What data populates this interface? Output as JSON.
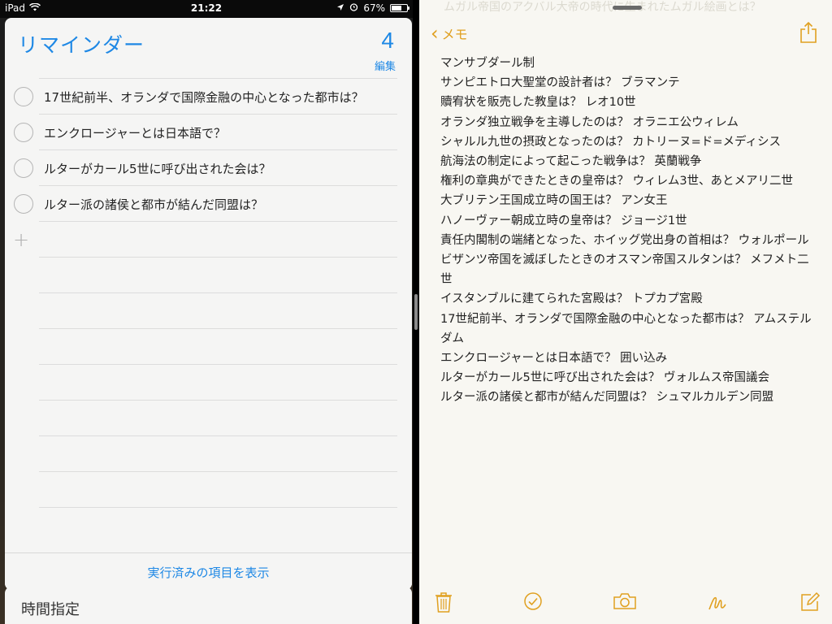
{
  "status_bar": {
    "device": "iPad",
    "time": "21:22",
    "battery": "67%",
    "battery_level": 0.67
  },
  "reminders": {
    "title": "リマインダー",
    "count": "4",
    "edit_label": "編集",
    "items": [
      "17世紀前半、オランダで国際金融の中心となった都市は？",
      "エンクロージャーとは日本語で？",
      "ルターがカール5世に呼び出された会は？",
      "ルター派の諸侯と都市が結んだ同盟は？"
    ],
    "show_completed_label": "実行済みの項目を表示",
    "next_list_title": "時間指定"
  },
  "notes": {
    "back_label": "メモ",
    "ghost_text": "ムガル帝国のアクバル大帝の時代に生まれたムガル絵画とは？",
    "lines": [
      "マンサブダール制",
      "サンピエトロ大聖堂の設計者は？ ブラマンテ",
      "贖宥状を販売した教皇は？ レオ10世",
      "オランダ独立戦争を主導したのは？ オラニエ公ウィレム",
      "シャルル九世の摂政となったのは？ カトリーヌ=ド=メディシス",
      "航海法の制定によって起こった戦争は？ 英蘭戦争",
      "権利の章典ができたときの皇帝は？ ウィレム3世、あとメアリ二世",
      "大ブリテン王国成立時の国王は？ アン女王",
      "ハノーヴァー朝成立時の皇帝は？ ジョージ1世",
      "責任内閣制の端緒となった、ホイッグ党出身の首相は？ ウォルポール",
      "ビザンツ帝国を滅ぼしたときのオスマン帝国スルタンは？ メフメト二世",
      "イスタンブルに建てられた宮殿は？ トプカプ宮殿",
      "17世紀前半、オランダで国際金融の中心となった都市は？ アムステルダム",
      "エンクロージャーとは日本語で？ 囲い込み",
      "ルターがカール5世に呼び出された会は？ ヴォルムス帝国議会",
      "ルター派の諸侯と都市が結んだ同盟は？ シュマルカルデン同盟"
    ],
    "toolbar_icons": [
      "trash-icon",
      "checklist-icon",
      "camera-icon",
      "sketch-icon",
      "compose-icon"
    ]
  },
  "colors": {
    "reminders_accent": "#1e88e5",
    "notes_accent": "#e0a020"
  }
}
